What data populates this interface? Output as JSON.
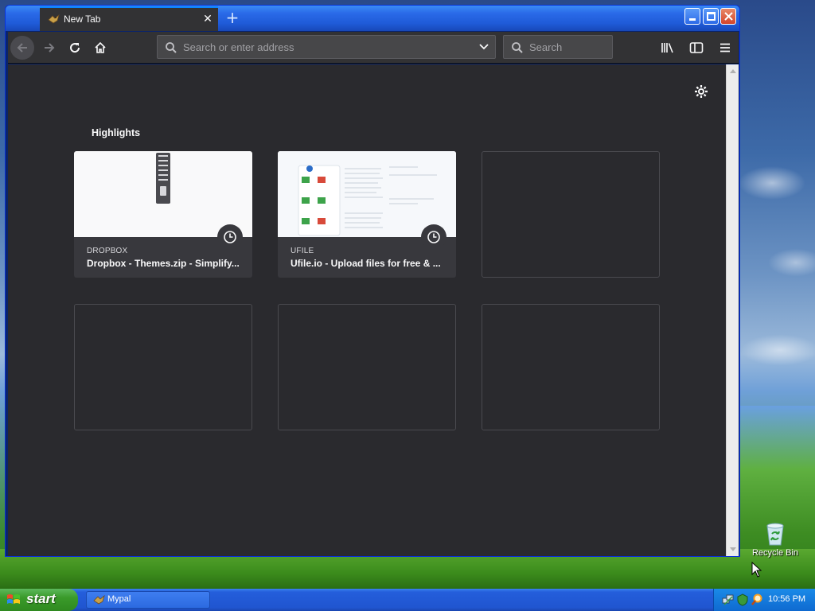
{
  "browser": {
    "tab_title": "New Tab",
    "url_placeholder": "Search or enter address",
    "search_placeholder": "Search"
  },
  "newtab": {
    "section_title": "Highlights",
    "highlights": [
      {
        "host": "DROPBOX",
        "title": "Dropbox - Themes.zip - Simplify...",
        "thumb": "zip-icon"
      },
      {
        "host": "UFILE",
        "title": "Ufile.io - Upload files for free & ...",
        "thumb": "upload-page"
      }
    ]
  },
  "desktop": {
    "recycle_bin_label": "Recycle Bin"
  },
  "taskbar": {
    "start_label": "start",
    "task_item_label": "Mypal",
    "clock": "10:56 PM"
  },
  "colors": {
    "accent": "#0a84ff",
    "content_bg": "#2a2a2e",
    "toolbar_bg": "#323234"
  }
}
